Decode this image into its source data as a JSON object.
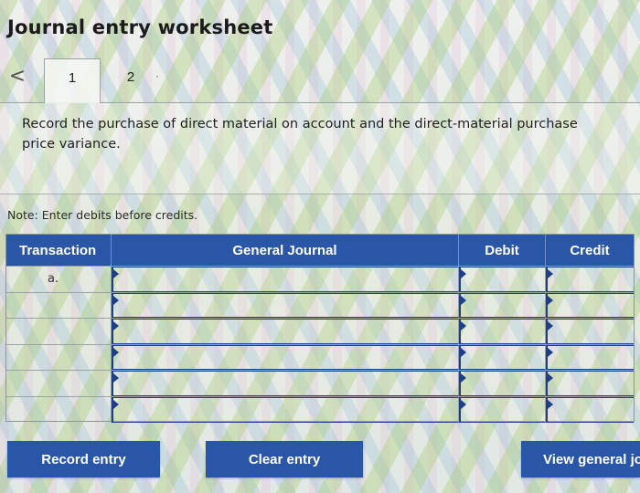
{
  "header": {
    "title": "Journal entry worksheet"
  },
  "tabs": [
    {
      "label": "1",
      "active": true
    },
    {
      "label": "2",
      "active": false
    }
  ],
  "nav": {
    "prev_icon": "chevron-left-icon",
    "prev_glyph": "<",
    "more_glyph": "·"
  },
  "instruction": "Record the purchase of direct material on account and the direct-material purchase price variance.",
  "note": "Note: Enter debits before credits.",
  "journal": {
    "columns": [
      "Transaction",
      "General Journal",
      "Debit",
      "Credit"
    ],
    "rows": [
      {
        "transaction": "a.",
        "account": "",
        "debit": "",
        "credit": ""
      },
      {
        "transaction": "",
        "account": "",
        "debit": "",
        "credit": ""
      },
      {
        "transaction": "",
        "account": "",
        "debit": "",
        "credit": ""
      },
      {
        "transaction": "",
        "account": "",
        "debit": "",
        "credit": ""
      },
      {
        "transaction": "",
        "account": "",
        "debit": "",
        "credit": ""
      },
      {
        "transaction": "",
        "account": "",
        "debit": "",
        "credit": ""
      }
    ]
  },
  "buttons": {
    "record": "Record entry",
    "clear": "Clear entry",
    "view": "View general jo"
  },
  "colors": {
    "primary_blue": "#2a56a7",
    "input_border": "#1e3f86",
    "text": "#222222"
  }
}
